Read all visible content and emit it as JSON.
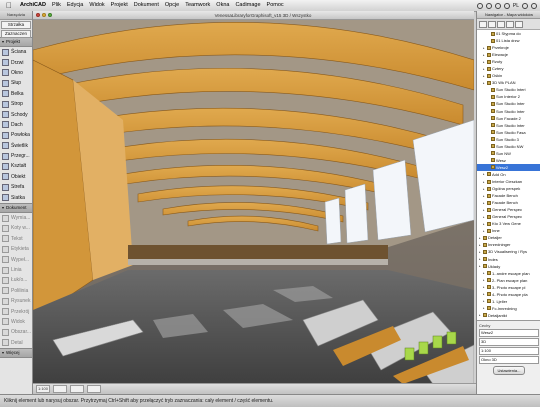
{
  "menubar": {
    "app_name": "ArchiCAD",
    "items": [
      "Plik",
      "Edycja",
      "Widok",
      "Projekt",
      "Dokument",
      "Opcje",
      "Teamwork",
      "Okna",
      "Cadimage",
      "Pomoc"
    ],
    "status": {
      "flag": "PL",
      "datetime": "",
      "user": ""
    }
  },
  "toolbox": {
    "title": "Narzędzia",
    "top_buttons": [
      "Strzałka",
      "Zaznaczen"
    ],
    "sections": [
      {
        "label": "Projekt",
        "tools": [
          {
            "label": "Ściana",
            "dim": false
          },
          {
            "label": "Drzwi",
            "dim": false
          },
          {
            "label": "Okno",
            "dim": false
          },
          {
            "label": "Słup",
            "dim": false
          },
          {
            "label": "Belka",
            "dim": false
          },
          {
            "label": "Strop",
            "dim": false
          },
          {
            "label": "Schody",
            "dim": false
          },
          {
            "label": "Dach",
            "dim": false
          },
          {
            "label": "Powłoka",
            "dim": false
          },
          {
            "label": "Świetlik",
            "dim": false
          },
          {
            "label": "Przegr...",
            "dim": false
          },
          {
            "label": "Kształt",
            "dim": false
          },
          {
            "label": "Obiekt",
            "dim": false
          },
          {
            "label": "Strefa",
            "dim": false
          },
          {
            "label": "Siatka",
            "dim": false
          }
        ]
      },
      {
        "label": "Dokument",
        "tools": [
          {
            "label": "Wymia...",
            "dim": true
          },
          {
            "label": "Koty w...",
            "dim": true
          },
          {
            "label": "Tekst",
            "dim": true
          },
          {
            "label": "Etykieta",
            "dim": true
          },
          {
            "label": "Wypeł...",
            "dim": true
          },
          {
            "label": "Linia",
            "dim": true
          },
          {
            "label": "Łuk/o...",
            "dim": true
          },
          {
            "label": "Polilinia",
            "dim": true
          },
          {
            "label": "Rysunek",
            "dim": true
          },
          {
            "label": "Przekrój",
            "dim": true
          },
          {
            "label": "Widok",
            "dim": true
          },
          {
            "label": "Obszar...",
            "dim": true
          },
          {
            "label": "Detal",
            "dim": true
          }
        ]
      },
      {
        "label": "Więcej",
        "tools": []
      }
    ]
  },
  "viewport": {
    "title": "VenessaLibraryforGraphisoft_v15 3D / Wszystko",
    "bottom": [
      "1:100",
      "",
      "",
      ""
    ]
  },
  "navigator": {
    "title": "Nawigator - Mapa widoków",
    "tree": [
      {
        "label": "01 Stypma do",
        "indent": 2
      },
      {
        "label": "01 Lista drzw",
        "indent": 2
      },
      {
        "label": "Przekroje",
        "indent": 1
      },
      {
        "label": "Elewacje",
        "indent": 1
      },
      {
        "label": "Rzuty",
        "indent": 1
      },
      {
        "label": "Cztery",
        "indent": 1
      },
      {
        "label": "Ośkin",
        "indent": 1
      },
      {
        "label": "3D Wk PLAN",
        "indent": 1
      },
      {
        "label": "Sun Studio Interi",
        "indent": 2
      },
      {
        "label": "Sun Interior 2",
        "indent": 2
      },
      {
        "label": "Sun Studio Inter",
        "indent": 2
      },
      {
        "label": "Sun Studio Inter",
        "indent": 2
      },
      {
        "label": "Sun Facade 2",
        "indent": 2
      },
      {
        "label": "Sun Studio Inter",
        "indent": 2
      },
      {
        "label": "Sun Studio Fasa",
        "indent": 2
      },
      {
        "label": "Sun Studio 3",
        "indent": 2
      },
      {
        "label": "Sun Studio NW",
        "indent": 2
      },
      {
        "label": "Sun NW",
        "indent": 2
      },
      {
        "label": "Wesz",
        "indent": 2
      },
      {
        "label": "Wesz2",
        "indent": 2
      },
      {
        "label": "Add On",
        "indent": 1
      },
      {
        "label": "Interior Cieszkan",
        "indent": 1
      },
      {
        "label": "Ogólna perspek",
        "indent": 1
      },
      {
        "label": "Facade Bench",
        "indent": 1
      },
      {
        "label": "Facade Bench",
        "indent": 1
      },
      {
        "label": "General Perspec",
        "indent": 1
      },
      {
        "label": "General Perspec",
        "indent": 1
      },
      {
        "label": "Kto 3 Vew Gene",
        "indent": 1
      },
      {
        "label": "Inne",
        "indent": 1
      },
      {
        "label": "Detaljer",
        "indent": 0
      },
      {
        "label": "Innredninger",
        "indent": 0
      },
      {
        "label": "3D Visualisering / Rys",
        "indent": 0
      },
      {
        "label": "Indes",
        "indent": 0
      },
      {
        "label": "Uklady",
        "indent": 0
      },
      {
        "label": "1- andre escape plan",
        "indent": 1
      },
      {
        "label": "2- Plan escape plan",
        "indent": 1
      },
      {
        "label": "3- Photo escape pl",
        "indent": 1
      },
      {
        "label": "4- Photo escape pla",
        "indent": 1
      },
      {
        "label": "1. Ljeller",
        "indent": 1
      },
      {
        "label": "Fc-Innredning",
        "indent": 1
      },
      {
        "label": "Detaljantkt",
        "indent": 0
      },
      {
        "label": "D. Proes",
        "indent": 0
      },
      {
        "label": "Detaljantkt",
        "indent": 0
      },
      {
        "label": "Ar 27 and one-gen",
        "indent": 1
      },
      {
        "label": "A1-37 Galleri gan",
        "indent": 1
      },
      {
        "label": "Detaljanikt",
        "indent": 0
      },
      {
        "label": "A1-27 Galleri gan",
        "indent": 1
      },
      {
        "label": "A1-27 Galleri gan",
        "indent": 1
      },
      {
        "label": "A1-27 Galleri gan",
        "indent": 1
      },
      {
        "label": "A1-27 Galleri gan",
        "indent": 1
      },
      {
        "label": "Detaljanikt",
        "indent": 0
      }
    ],
    "selected_index": 19,
    "panel": {
      "heading": "Cechy",
      "name_value": "Wesz2",
      "view_field": "3D",
      "scale_field": "1:100",
      "layers_field": "Okno 3D",
      "button": "Ustawienia..."
    }
  },
  "statusbar": {
    "text": "Kliknij element lub narysuj obszar. Przytrzymaj Ctrl+Shift aby przełączyć tryb zaznaczania: cały element / część elementu."
  }
}
